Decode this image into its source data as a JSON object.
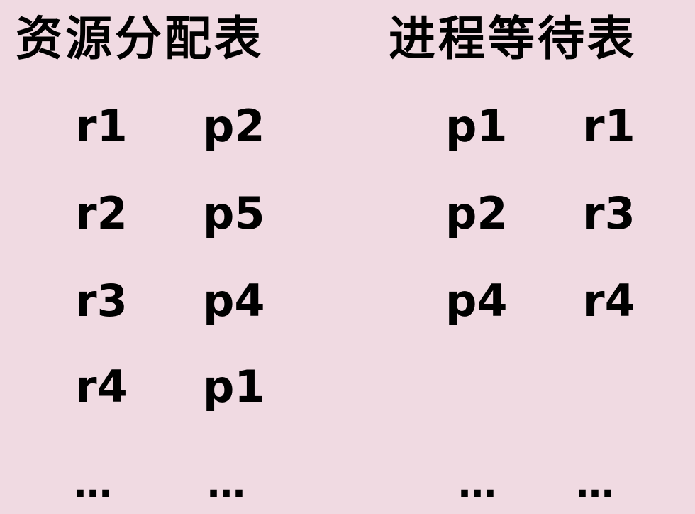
{
  "allocation_table": {
    "title": "资源分配表",
    "rows": [
      {
        "resource": "r1",
        "process": "p2"
      },
      {
        "resource": "r2",
        "process": "p5"
      },
      {
        "resource": "r3",
        "process": "p4"
      },
      {
        "resource": "r4",
        "process": "p1"
      }
    ],
    "ellipsis": [
      "…",
      "…"
    ]
  },
  "wait_table": {
    "title": "进程等待表",
    "rows": [
      {
        "process": "p1",
        "resource": "r1"
      },
      {
        "process": "p2",
        "resource": "r3"
      },
      {
        "process": "p4",
        "resource": "r4"
      }
    ],
    "ellipsis": [
      "…",
      "…"
    ]
  }
}
